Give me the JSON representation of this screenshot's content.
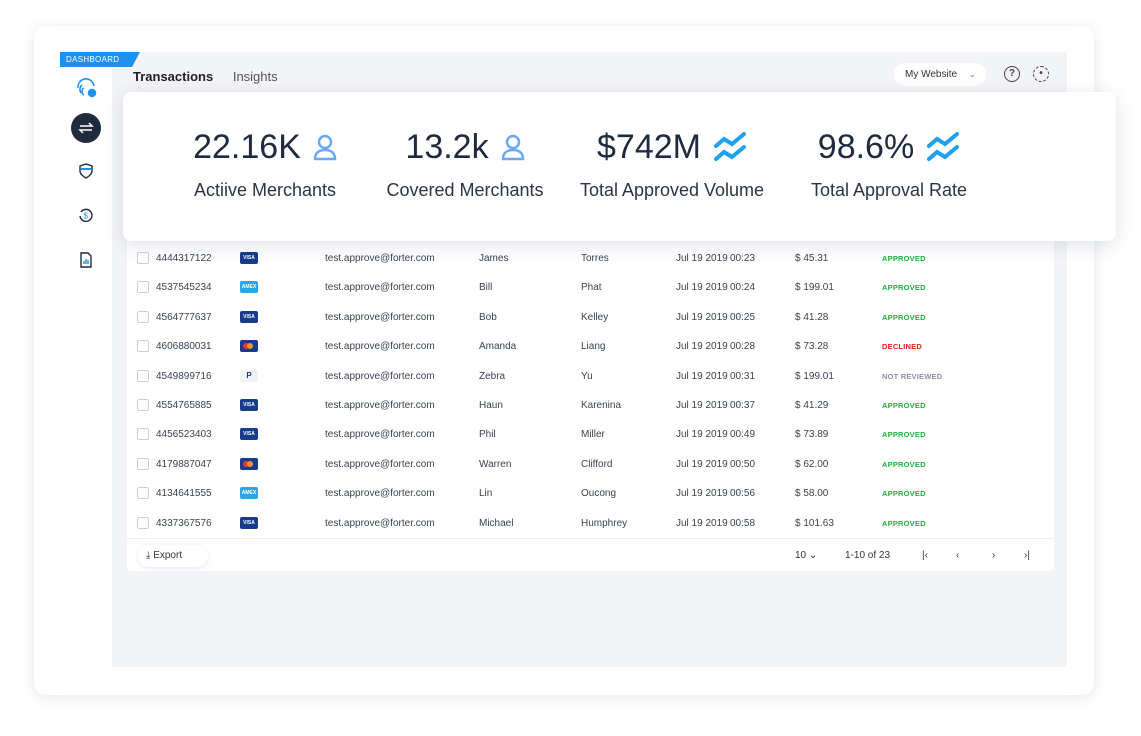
{
  "badge": "DASHBOARD",
  "tabs": [
    "Transactions",
    "Insights"
  ],
  "site_selector": "My Website",
  "stats": [
    {
      "value": "22.16K",
      "label": "Actiive Merchants",
      "icon": "user-icon"
    },
    {
      "value": "13.2k",
      "label": "Covered Merchants",
      "icon": "user-icon"
    },
    {
      "value": "$742M",
      "label": "Total Approved Volume",
      "icon": "trend-icon"
    },
    {
      "value": "98.6%",
      "label": "Total Approval Rate",
      "icon": "trend-icon"
    }
  ],
  "rows": [
    {
      "id": "4444317122",
      "card": "VISA",
      "email": "test.approve@forter.com",
      "first": "James",
      "last": "Torres",
      "date": "Jul 19 2019",
      "time": "00:23",
      "amount": "$ 45.31",
      "status": "APPROVED"
    },
    {
      "id": "4537545234",
      "card": "AMEX",
      "email": "test.approve@forter.com",
      "first": "Bill",
      "last": "Phat",
      "date": "Jul 19 2019",
      "time": "00:24",
      "amount": "$ 199.01",
      "status": "APPROVED"
    },
    {
      "id": "4564777637",
      "card": "VISA",
      "email": "test.approve@forter.com",
      "first": "Bob",
      "last": "Kelley",
      "date": "Jul 19 2019",
      "time": "00:25",
      "amount": "$ 41.28",
      "status": "APPROVED"
    },
    {
      "id": "4606880031",
      "card": "MC",
      "email": "test.approve@forter.com",
      "first": "Amanda",
      "last": "Liang",
      "date": "Jul 19 2019",
      "time": "00:28",
      "amount": "$ 73.28",
      "status": "DECLINED"
    },
    {
      "id": "4549899716",
      "card": "PP",
      "email": "test.approve@forter.com",
      "first": "Zebra",
      "last": "Yu",
      "date": "Jul 19 2019",
      "time": "00:31",
      "amount": "$ 199.01",
      "status": "NOT REVIEWED"
    },
    {
      "id": "4554765885",
      "card": "VISA",
      "email": "test.approve@forter.com",
      "first": "Haun",
      "last": "Karenina",
      "date": "Jul 19 2019",
      "time": "00:37",
      "amount": "$ 41.29",
      "status": "APPROVED"
    },
    {
      "id": "4456523403",
      "card": "VISA",
      "email": "test.approve@forter.com",
      "first": "Phil",
      "last": "Miller",
      "date": "Jul 19 2019",
      "time": "00:49",
      "amount": "$ 73.89",
      "status": "APPROVED"
    },
    {
      "id": "4179887047",
      "card": "MC",
      "email": "test.approve@forter.com",
      "first": "Warren",
      "last": "Clifford",
      "date": "Jul 19 2019",
      "time": "00:50",
      "amount": "$ 62.00",
      "status": "APPROVED"
    },
    {
      "id": "4134641555",
      "card": "AMEX",
      "email": "test.approve@forter.com",
      "first": "Lin",
      "last": "Oucong",
      "date": "Jul 19 2019",
      "time": "00:56",
      "amount": "$ 58.00",
      "status": "APPROVED"
    },
    {
      "id": "4337367576",
      "card": "VISA",
      "email": "test.approve@forter.com",
      "first": "Michael",
      "last": "Humphrey",
      "date": "Jul 19 2019",
      "time": "00:58",
      "amount": "$ 101.63",
      "status": "APPROVED"
    }
  ],
  "footer": {
    "export": "Export",
    "page_size": "10",
    "range": "1-10 of 23"
  },
  "colors": {
    "approved": "#1db33a",
    "declined": "#e02020",
    "not_reviewed": "#8a93a3",
    "accent": "#1e90f0",
    "visa": "#1a3a8c",
    "amex": "#2aa6e6"
  }
}
